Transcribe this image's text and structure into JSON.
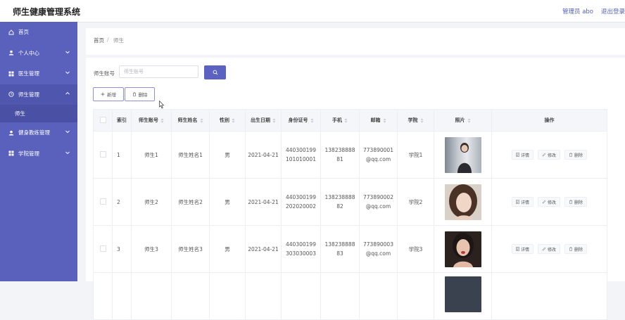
{
  "header": {
    "title": "师生健康管理系统",
    "user": "管理员 abo",
    "logout": "退出登录"
  },
  "sidebar": {
    "items": [
      {
        "label": "首页"
      },
      {
        "label": "个人中心"
      },
      {
        "label": "医生管理"
      },
      {
        "label": "师生管理"
      },
      {
        "label": "健身教练管理"
      },
      {
        "label": "学院管理"
      }
    ],
    "sub": {
      "label": "师生"
    }
  },
  "breadcrumb": {
    "home": "首页",
    "sep": "/",
    "current": "师生"
  },
  "search": {
    "label": "师生账号",
    "placeholder": "师生账号"
  },
  "actions": {
    "add": "新增",
    "delete": "删除"
  },
  "table": {
    "headers": {
      "index": "索引",
      "account": "师生账号",
      "name": "师生姓名",
      "gender": "性别",
      "birthday": "出生日期",
      "idcard": "身份证号",
      "phone": "手机",
      "email": "邮箱",
      "college": "学院",
      "photo": "照片",
      "ops": "操作"
    },
    "rows": [
      {
        "index": "1",
        "account": "师生1",
        "name": "师生姓名1",
        "gender": "男",
        "birthday": "2021-04-21",
        "idcard_a": "440300199",
        "idcard_b": "101010001",
        "phone_a": "138238888",
        "phone_b": "81",
        "email_a": "773890001",
        "email_b": "@qq.com",
        "college": "学院1"
      },
      {
        "index": "2",
        "account": "师生2",
        "name": "师生姓名2",
        "gender": "男",
        "birthday": "2021-04-21",
        "idcard_a": "440300199",
        "idcard_b": "202020002",
        "phone_a": "138238888",
        "phone_b": "82",
        "email_a": "773890002",
        "email_b": "@qq.com",
        "college": "学院2"
      },
      {
        "index": "3",
        "account": "师生3",
        "name": "师生姓名3",
        "gender": "男",
        "birthday": "2021-04-21",
        "idcard_a": "440300199",
        "idcard_b": "303030003",
        "phone_a": "138238888",
        "phone_b": "83",
        "email_a": "773890003",
        "email_b": "@qq.com",
        "college": "学院3"
      }
    ],
    "ops": {
      "detail": "详情",
      "edit": "修改",
      "delete": "删除"
    }
  },
  "colors": {
    "sidebar": "#5a61bd",
    "accent": "#5b62c1",
    "header_text": "#5560b4"
  }
}
